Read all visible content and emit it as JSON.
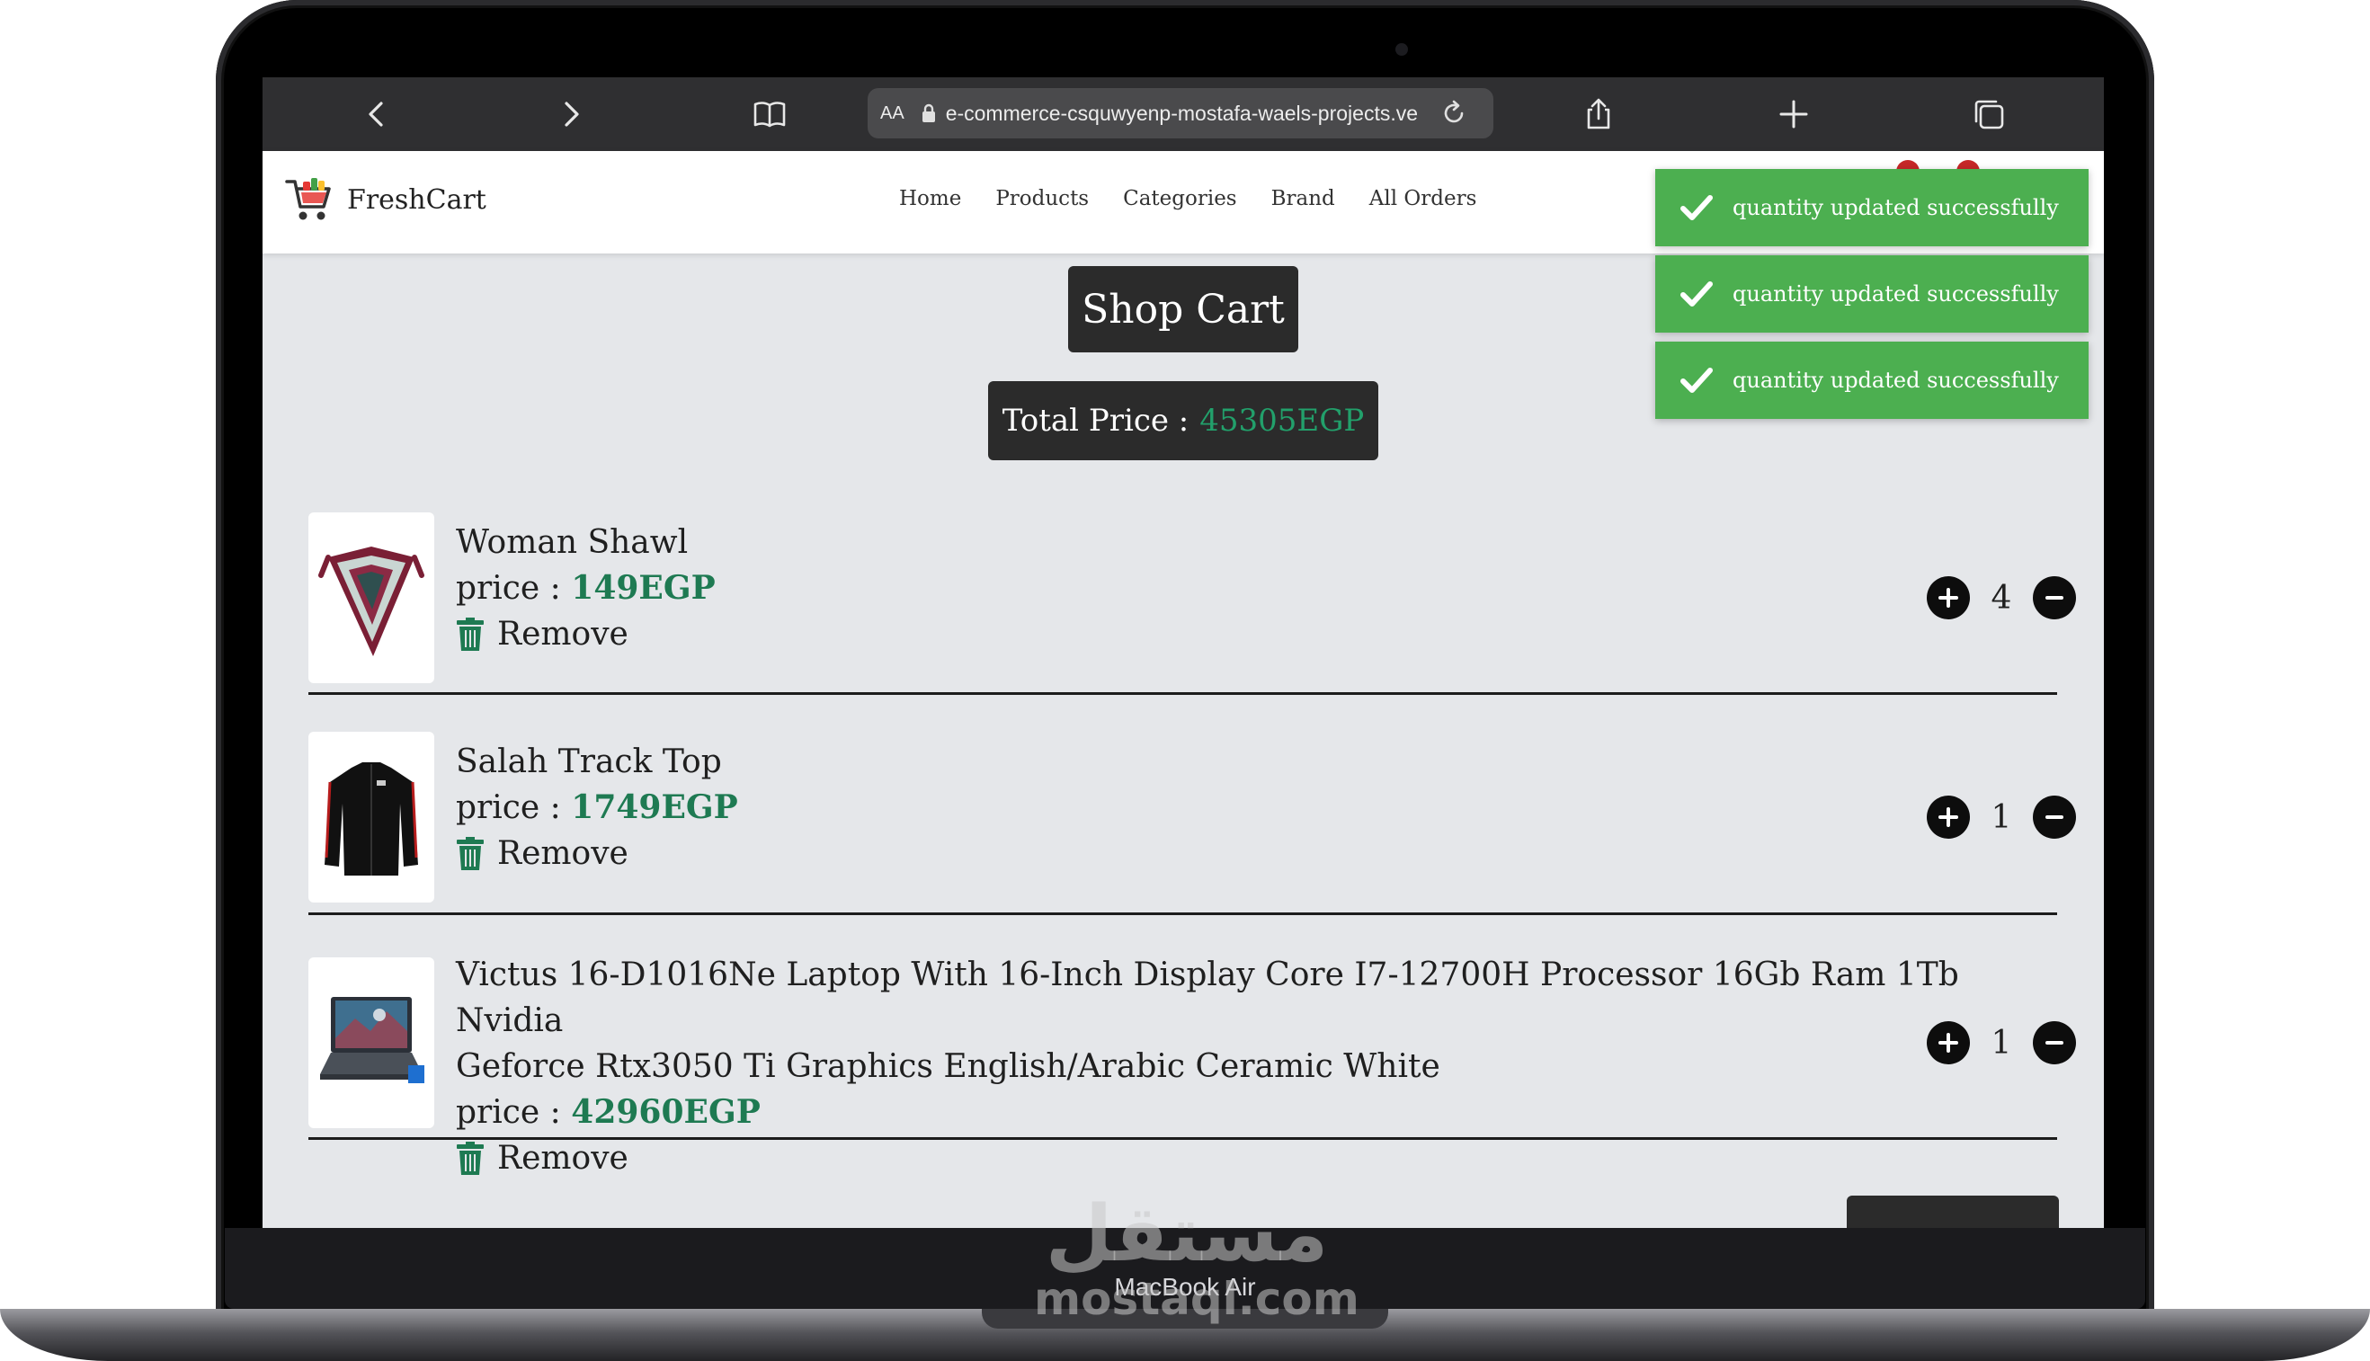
{
  "browser": {
    "url_aa": "AA",
    "url": "e-commerce-csquwyenp-mostafa-waels-projects.ve"
  },
  "site": {
    "brand": "FreshCart",
    "nav": [
      "Home",
      "Products",
      "Categories",
      "Brand",
      "All Orders"
    ]
  },
  "toasts": [
    "quantity updated successfully",
    "quantity updated successfully",
    "quantity updated successfully"
  ],
  "cart": {
    "title": "Shop Cart",
    "total_label": "Total Price :",
    "total_value": "45305EGP",
    "price_label": "price :",
    "remove_label": "Remove",
    "items": [
      {
        "name": "Woman Shawl",
        "price": "149EGP",
        "quantity": "4"
      },
      {
        "name": "Salah Track Top",
        "price": "1749EGP",
        "quantity": "1"
      },
      {
        "name_line1": "Victus 16-D1016Ne Laptop With 16-Inch Display Core I7-12700H Processor 16Gb Ram 1Tb Nvidia",
        "name_line2": "Geforce Rtx3050 Ti Graphics English/Arabic Ceramic White",
        "price": "42960EGP",
        "quantity": "1"
      }
    ]
  },
  "device": {
    "model": "MacBook Air"
  },
  "watermark": {
    "arabic": "مستقل",
    "latin": "mostaql.com"
  },
  "colors": {
    "toast": "#4caf50",
    "price": "#1e7a52",
    "total": "#22a06b",
    "page_bg": "#e5e7ea"
  }
}
